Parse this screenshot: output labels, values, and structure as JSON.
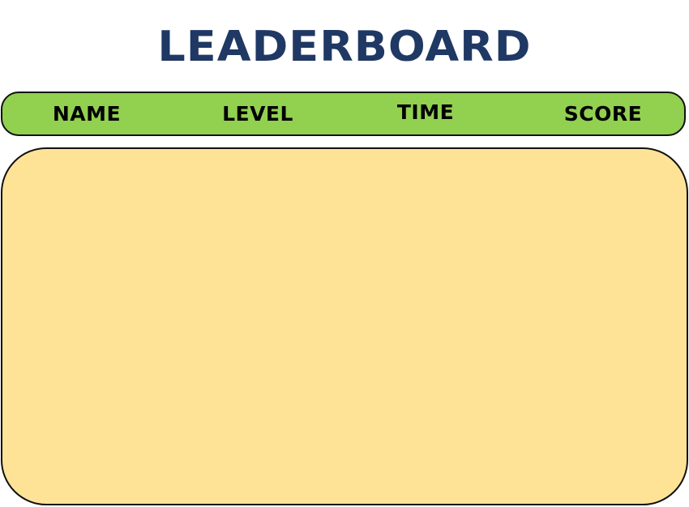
{
  "title": "LEADERBOARD",
  "columns": {
    "name": "NAME",
    "level": "LEVEL",
    "time": "TIME",
    "score": "SCORE"
  },
  "colors": {
    "title": "#1f3864",
    "header_bar": "#92d050",
    "board_panel": "#fee397",
    "outline": "#111111"
  }
}
